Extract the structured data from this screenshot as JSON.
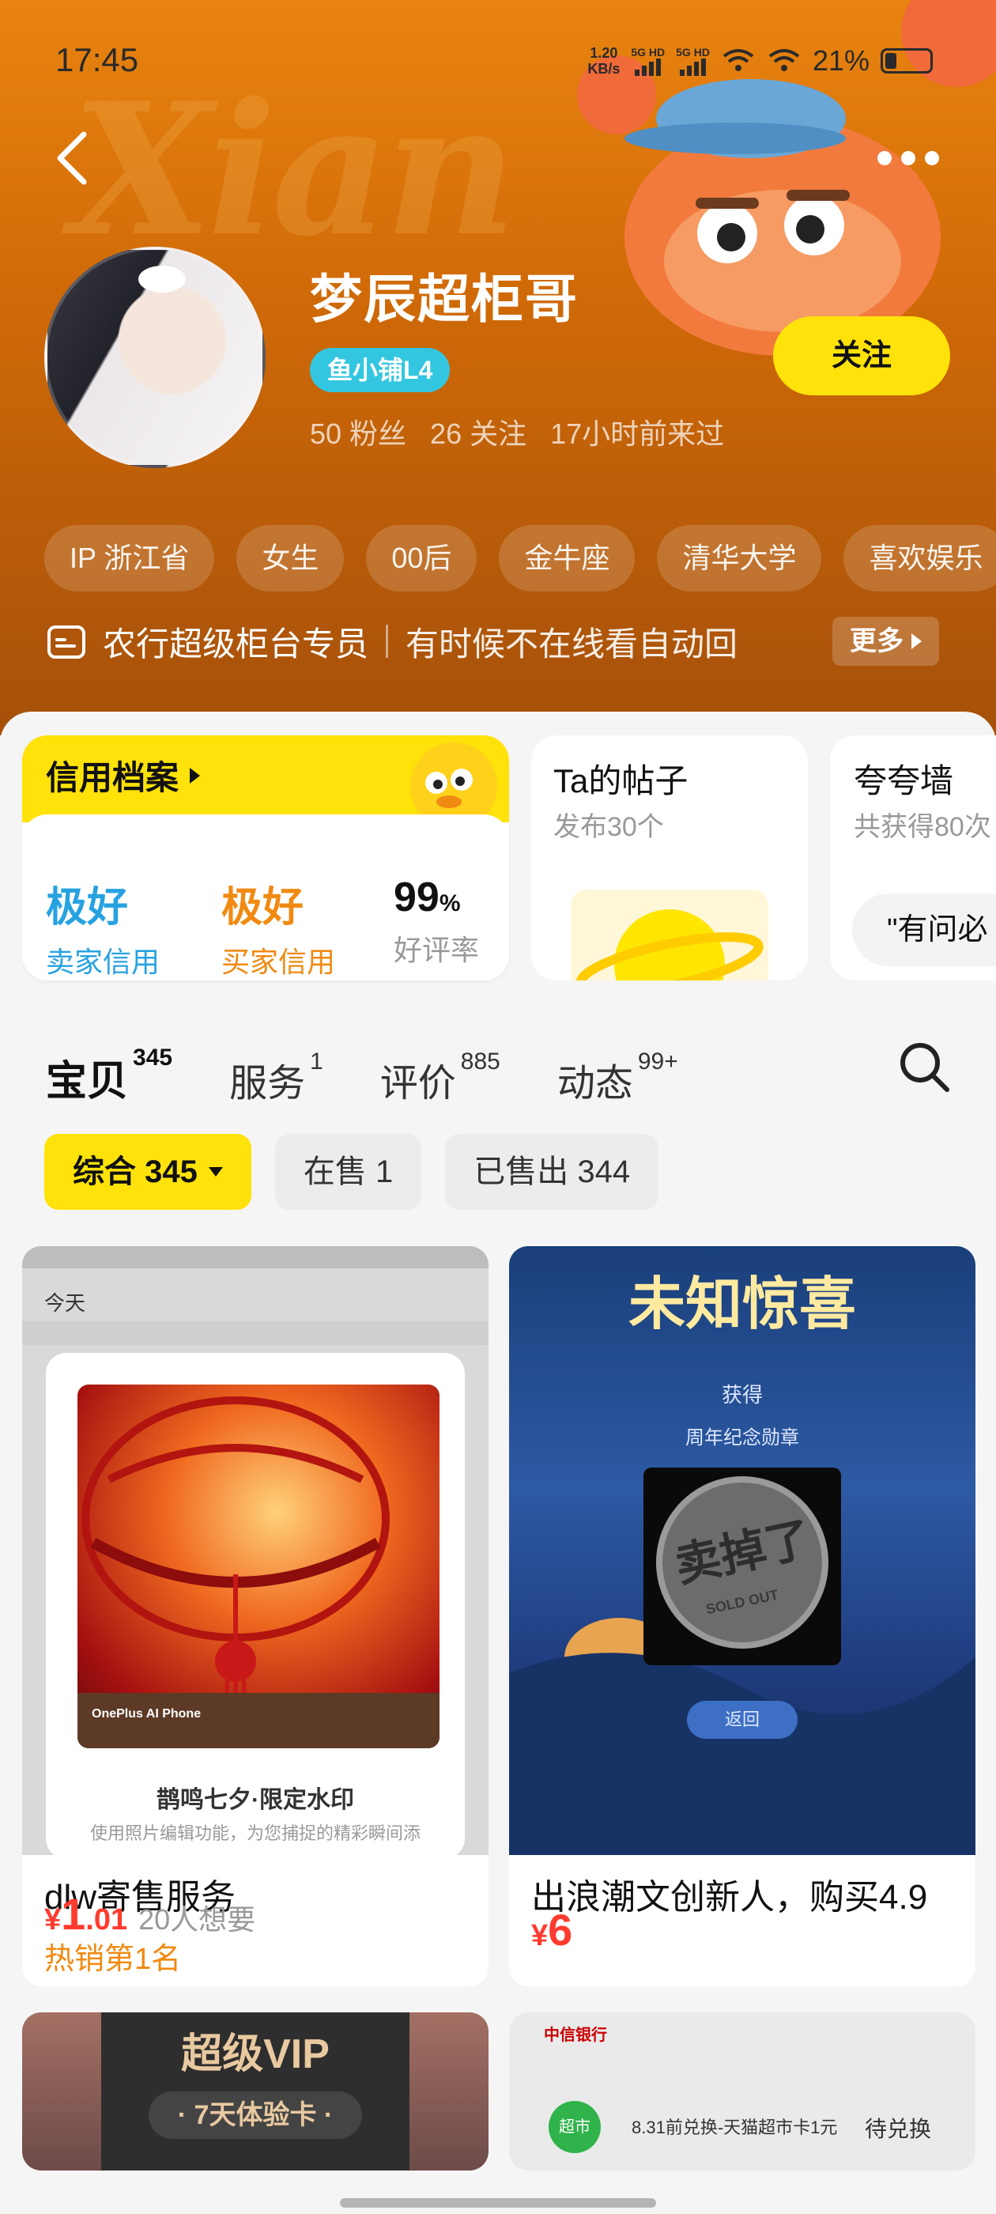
{
  "status_bar": {
    "time": "17:45",
    "net_speed_value": "1.20",
    "net_speed_unit": "KB/s",
    "sim1": "5G HD",
    "sim2": "5G HD",
    "battery": "21%"
  },
  "header": {
    "bg_watermark": "Xian",
    "nickname": "梦辰超柜哥",
    "level_badge": "鱼小铺L4",
    "stats": [
      "50 粉丝",
      "26 关注",
      "17小时前来过"
    ],
    "follow_button": "关注",
    "tags": [
      "IP 浙江省",
      "女生",
      "00后",
      "金牛座",
      "清华大学",
      "喜欢娱乐"
    ],
    "bio_title": "农行超级柜台专员",
    "bio_text": "有时候不在线看自动回",
    "bio_more": "更多"
  },
  "credit": {
    "title": "信用档案",
    "seller_value": "极好",
    "seller_label": "卖家信用",
    "buyer_value": "极好",
    "buyer_label": "买家信用",
    "rate_value": "99",
    "rate_unit": "%",
    "rate_label": "好评率"
  },
  "posts_card": {
    "title": "Ta的帖子",
    "subtitle": "发布30个"
  },
  "praise_card": {
    "title": "夸夸墙",
    "subtitle": "共获得80次",
    "quote": "\"有问必"
  },
  "tabs": [
    {
      "label": "宝贝",
      "count": "345"
    },
    {
      "label": "服务",
      "count": "1"
    },
    {
      "label": "评价",
      "count": "885"
    },
    {
      "label": "动态",
      "count": "99+"
    }
  ],
  "filters": [
    "综合 345",
    "在售 1",
    "已售出 344"
  ],
  "products": [
    {
      "title": "dlw寄售服务",
      "rank": "热销第1名",
      "price_symbol": "¥",
      "price_int": "1",
      "price_dec": ".01",
      "wants": "20人想要",
      "img_day": "今天",
      "img_phone": "OnePlus AI Phone",
      "img_title": "鹊鸣七夕·限定水印",
      "img_sub": "使用照片编辑功能，为您捕捉的精彩瞬间添"
    },
    {
      "title": "出浪潮文创新人，购买4.9",
      "price_symbol": "¥",
      "price_int": "6",
      "img_headline": "未知惊喜",
      "img_get": "获得",
      "img_line": "周年纪念勋章",
      "img_stamp": "卖掉了",
      "img_stamp_sub": "SOLD OUT",
      "img_back": "返回"
    },
    {
      "img_text": "超级VIP",
      "img_sub": "· 7天体验卡 ·"
    },
    {
      "img_bank": "中信银行",
      "img_text": "8.31前兑换-天猫超市卡1元",
      "img_btn": "待兑换",
      "img_icon": "超市"
    }
  ]
}
